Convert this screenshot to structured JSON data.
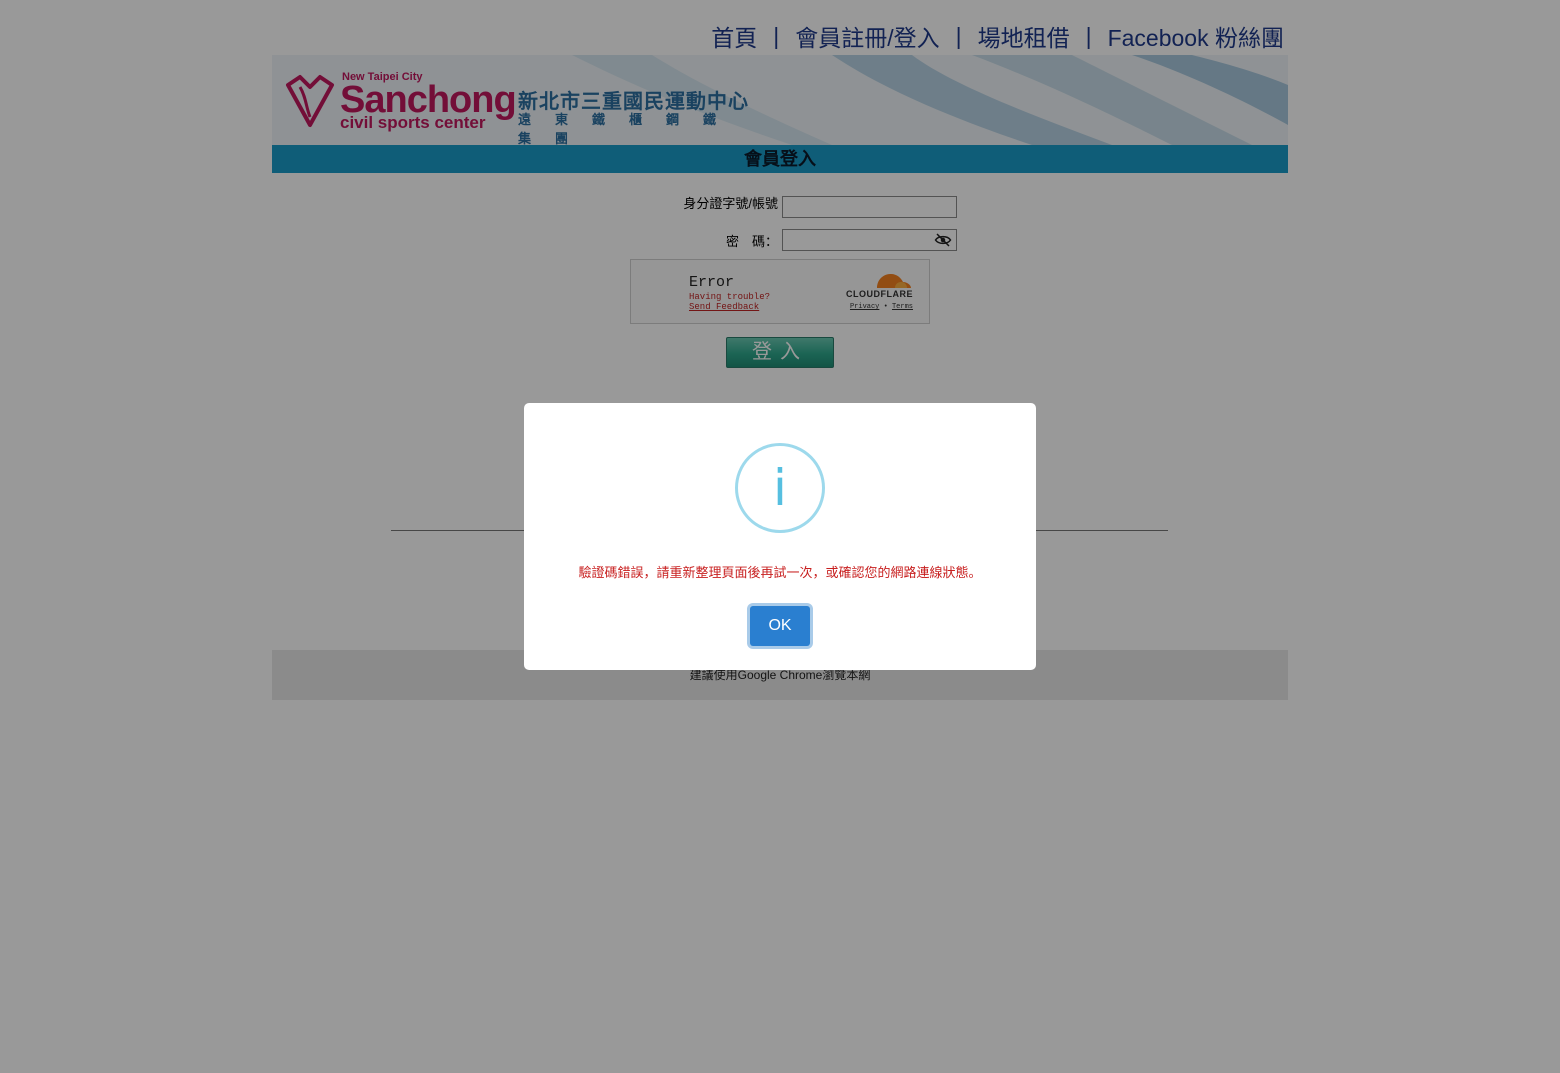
{
  "topnav": {
    "items": [
      {
        "label": "首頁"
      },
      {
        "label": "會員註冊/登入"
      },
      {
        "label": "場地租借"
      },
      {
        "label": "Facebook 粉絲團"
      }
    ],
    "separator": "|"
  },
  "banner": {
    "logo_top": "New Taipei City",
    "logo_name": "Sanchong",
    "logo_sub": "civil sports center",
    "logo_cn": "新北市三重國民運動中心",
    "logo_cn2": "遠東鐵櫃鋼鐵集團"
  },
  "page_title": "會員登入",
  "form": {
    "account_label": "身分證字號/帳號",
    "account_value": "",
    "password_label": "密　碼：",
    "password_value": "",
    "login_label": "登入"
  },
  "cloudflare": {
    "error": "Error",
    "trouble": "Having trouble?",
    "feedback": "Send Feedback",
    "brand": "CLOUDFLARE",
    "privacy": "Privacy",
    "dot": "•",
    "terms": "Terms"
  },
  "footer": {
    "text": "建議使用Google Chrome瀏覽本網"
  },
  "dialog": {
    "icon": "i",
    "message": "驗證碼錯誤，請重新整理頁面後再試一次，或確認您的網路連線狀態。",
    "ok_label": "OK"
  },
  "colors": {
    "title_bar": "#1a9bc9",
    "brand_magenta": "#c0185e",
    "link_blue": "#1e3a8a",
    "ok_button": "#2a7fd0",
    "info_icon": "#56bfe0",
    "message_red": "#c82020"
  },
  "icons": {
    "password_toggle": "eye-off-icon",
    "dialog_icon": "info-icon",
    "logo": "heart-diamond-icon"
  }
}
